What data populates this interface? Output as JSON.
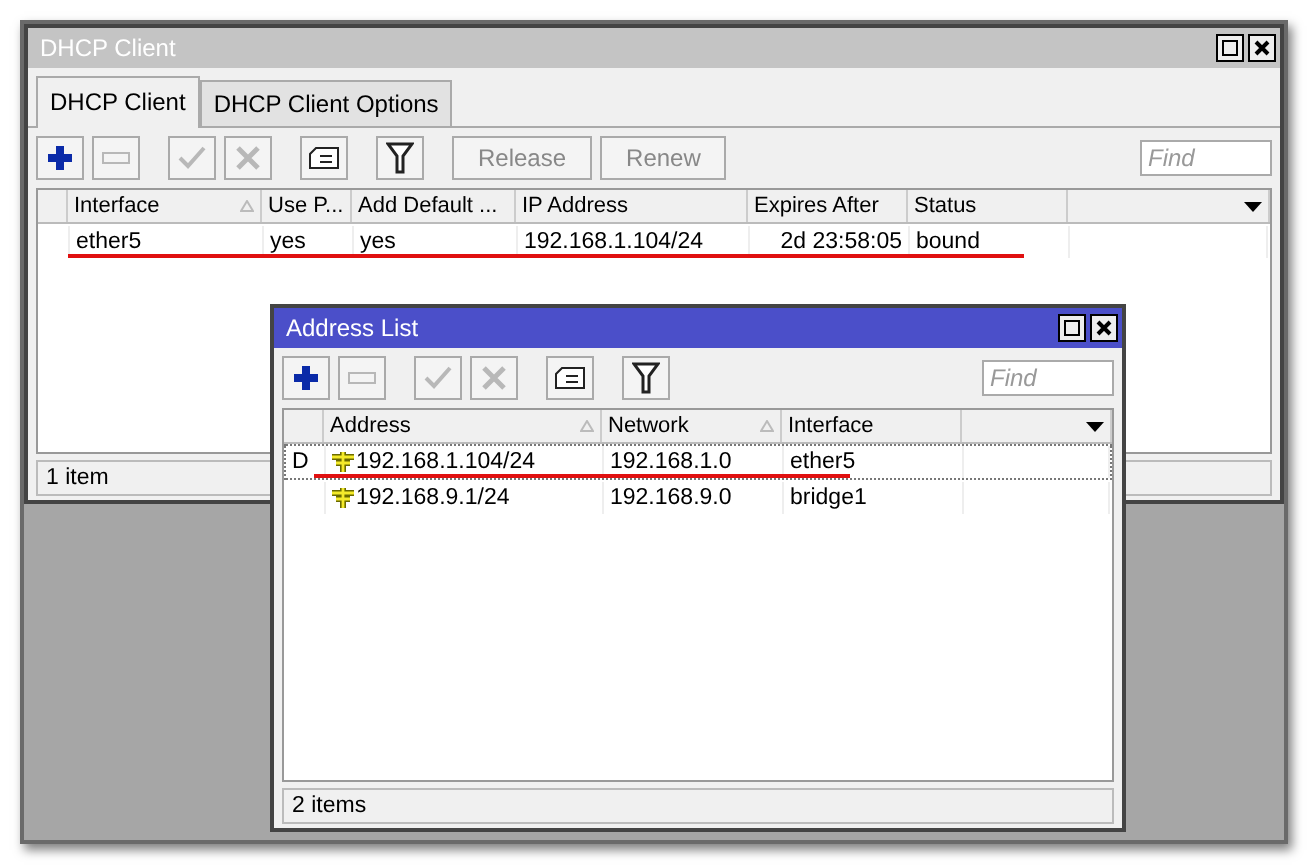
{
  "dhcp_window": {
    "title": "DHCP Client",
    "tabs": [
      {
        "label": "DHCP Client",
        "selected": true
      },
      {
        "label": "DHCP Client Options",
        "selected": false
      }
    ],
    "toolbar": [
      {
        "kind": "add",
        "disabled": false
      },
      {
        "kind": "remove",
        "disabled": true
      },
      {
        "kind": "enable",
        "disabled": true
      },
      {
        "kind": "disable",
        "disabled": true
      },
      {
        "kind": "comment",
        "disabled": false
      },
      {
        "kind": "filter",
        "disabled": false
      }
    ],
    "text_buttons": [
      {
        "label": "Release",
        "disabled": true
      },
      {
        "label": "Renew",
        "disabled": true
      }
    ],
    "find": {
      "placeholder": "Find"
    },
    "table": {
      "columns": [
        {
          "label": "Interface",
          "sort_indicator": true
        },
        {
          "label": "Use P...",
          "sort_indicator": false
        },
        {
          "label": "Add Default ...",
          "sort_indicator": false
        },
        {
          "label": "IP Address",
          "sort_indicator": false
        },
        {
          "label": "Expires After",
          "sort_indicator": false
        },
        {
          "label": "Status",
          "sort_indicator": false
        }
      ],
      "rows": [
        {
          "selected": false,
          "underlined": true,
          "cells": [
            "ether5",
            "yes",
            "yes",
            "192.168.1.104/24",
            "2d 23:58:05",
            "bound"
          ]
        }
      ]
    },
    "status_bar": "1 item"
  },
  "address_window": {
    "title": "Address List",
    "toolbar": [
      {
        "kind": "add",
        "disabled": false
      },
      {
        "kind": "remove",
        "disabled": true
      },
      {
        "kind": "enable",
        "disabled": true
      },
      {
        "kind": "disable",
        "disabled": true
      },
      {
        "kind": "comment",
        "disabled": false
      },
      {
        "kind": "filter",
        "disabled": false
      }
    ],
    "find": {
      "placeholder": "Find"
    },
    "table": {
      "columns": [
        {
          "label": "Address",
          "sort_indicator": true
        },
        {
          "label": "Network",
          "sort_indicator": true
        },
        {
          "label": "Interface",
          "sort_indicator": false
        }
      ],
      "rows": [
        {
          "selected": true,
          "underlined": true,
          "flag": "D",
          "cells": [
            "192.168.1.104/24",
            "192.168.1.0",
            "ether5"
          ]
        },
        {
          "selected": false,
          "underlined": false,
          "cells": [
            "192.168.9.1/24",
            "192.168.9.0",
            "bridge1"
          ]
        }
      ]
    },
    "status_bar": "2 items"
  }
}
